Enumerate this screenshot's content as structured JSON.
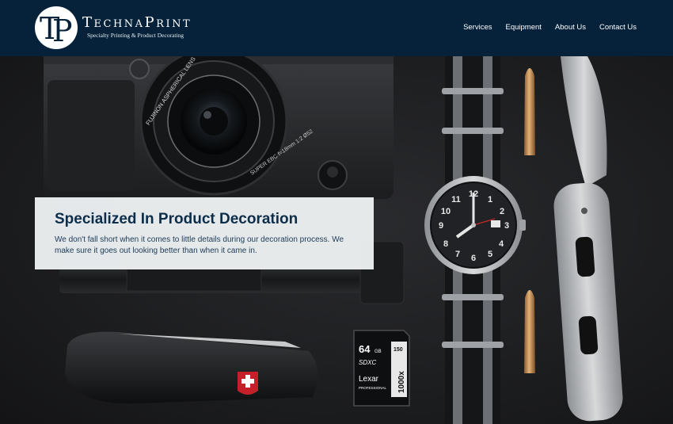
{
  "brand": {
    "logo_text": "TP",
    "name": "TechnaPrint",
    "tagline": "Specialty Printing & Product Decorating"
  },
  "nav": {
    "items": [
      {
        "label": "Services"
      },
      {
        "label": "Equipment"
      },
      {
        "label": "About Us"
      },
      {
        "label": "Contact Us"
      }
    ]
  },
  "hero": {
    "title": "Specialized In Product Decoration",
    "text": "We don't fall short when it comes to little details during our decoration process. We make sure it goes out looking better than when it came in.",
    "photo_labels": {
      "lens_ring": "FUJINON ASPHERICAL LENS",
      "lens_spec": "SUPER EBC f=18mm 1:2 Ø52",
      "sd_capacity": "64",
      "sd_unit": "GB",
      "sd_class": "SDXC",
      "sd_brand": "Lexar",
      "sd_line": "PROFESSIONAL",
      "sd_speed": "1000x",
      "sd_rate": "150"
    }
  },
  "colors": {
    "header_bg": "#05223a",
    "card_title": "#0c2e4b",
    "card_bg": "#f2f5f7"
  }
}
